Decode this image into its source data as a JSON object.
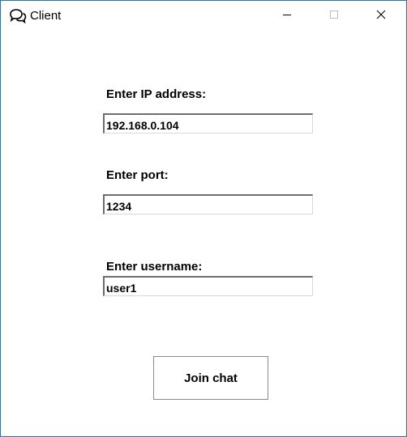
{
  "window": {
    "title": "Client",
    "title_icon": "chat-bubbles-icon",
    "controls": [
      "minimize-icon",
      "maximize-icon",
      "close-icon"
    ]
  },
  "form": {
    "ip": {
      "label": "Enter IP address:",
      "value": "192.168.0.104"
    },
    "port": {
      "label": "Enter port:",
      "value": "1234"
    },
    "username": {
      "label": "Enter username:",
      "value": "user1"
    },
    "join_label": "Join chat"
  },
  "colors": {
    "window_border": "#1f74c4",
    "background": "#ffffff",
    "field_border_dark": "#6d6d6d",
    "button_border": "#8a8a8a"
  }
}
